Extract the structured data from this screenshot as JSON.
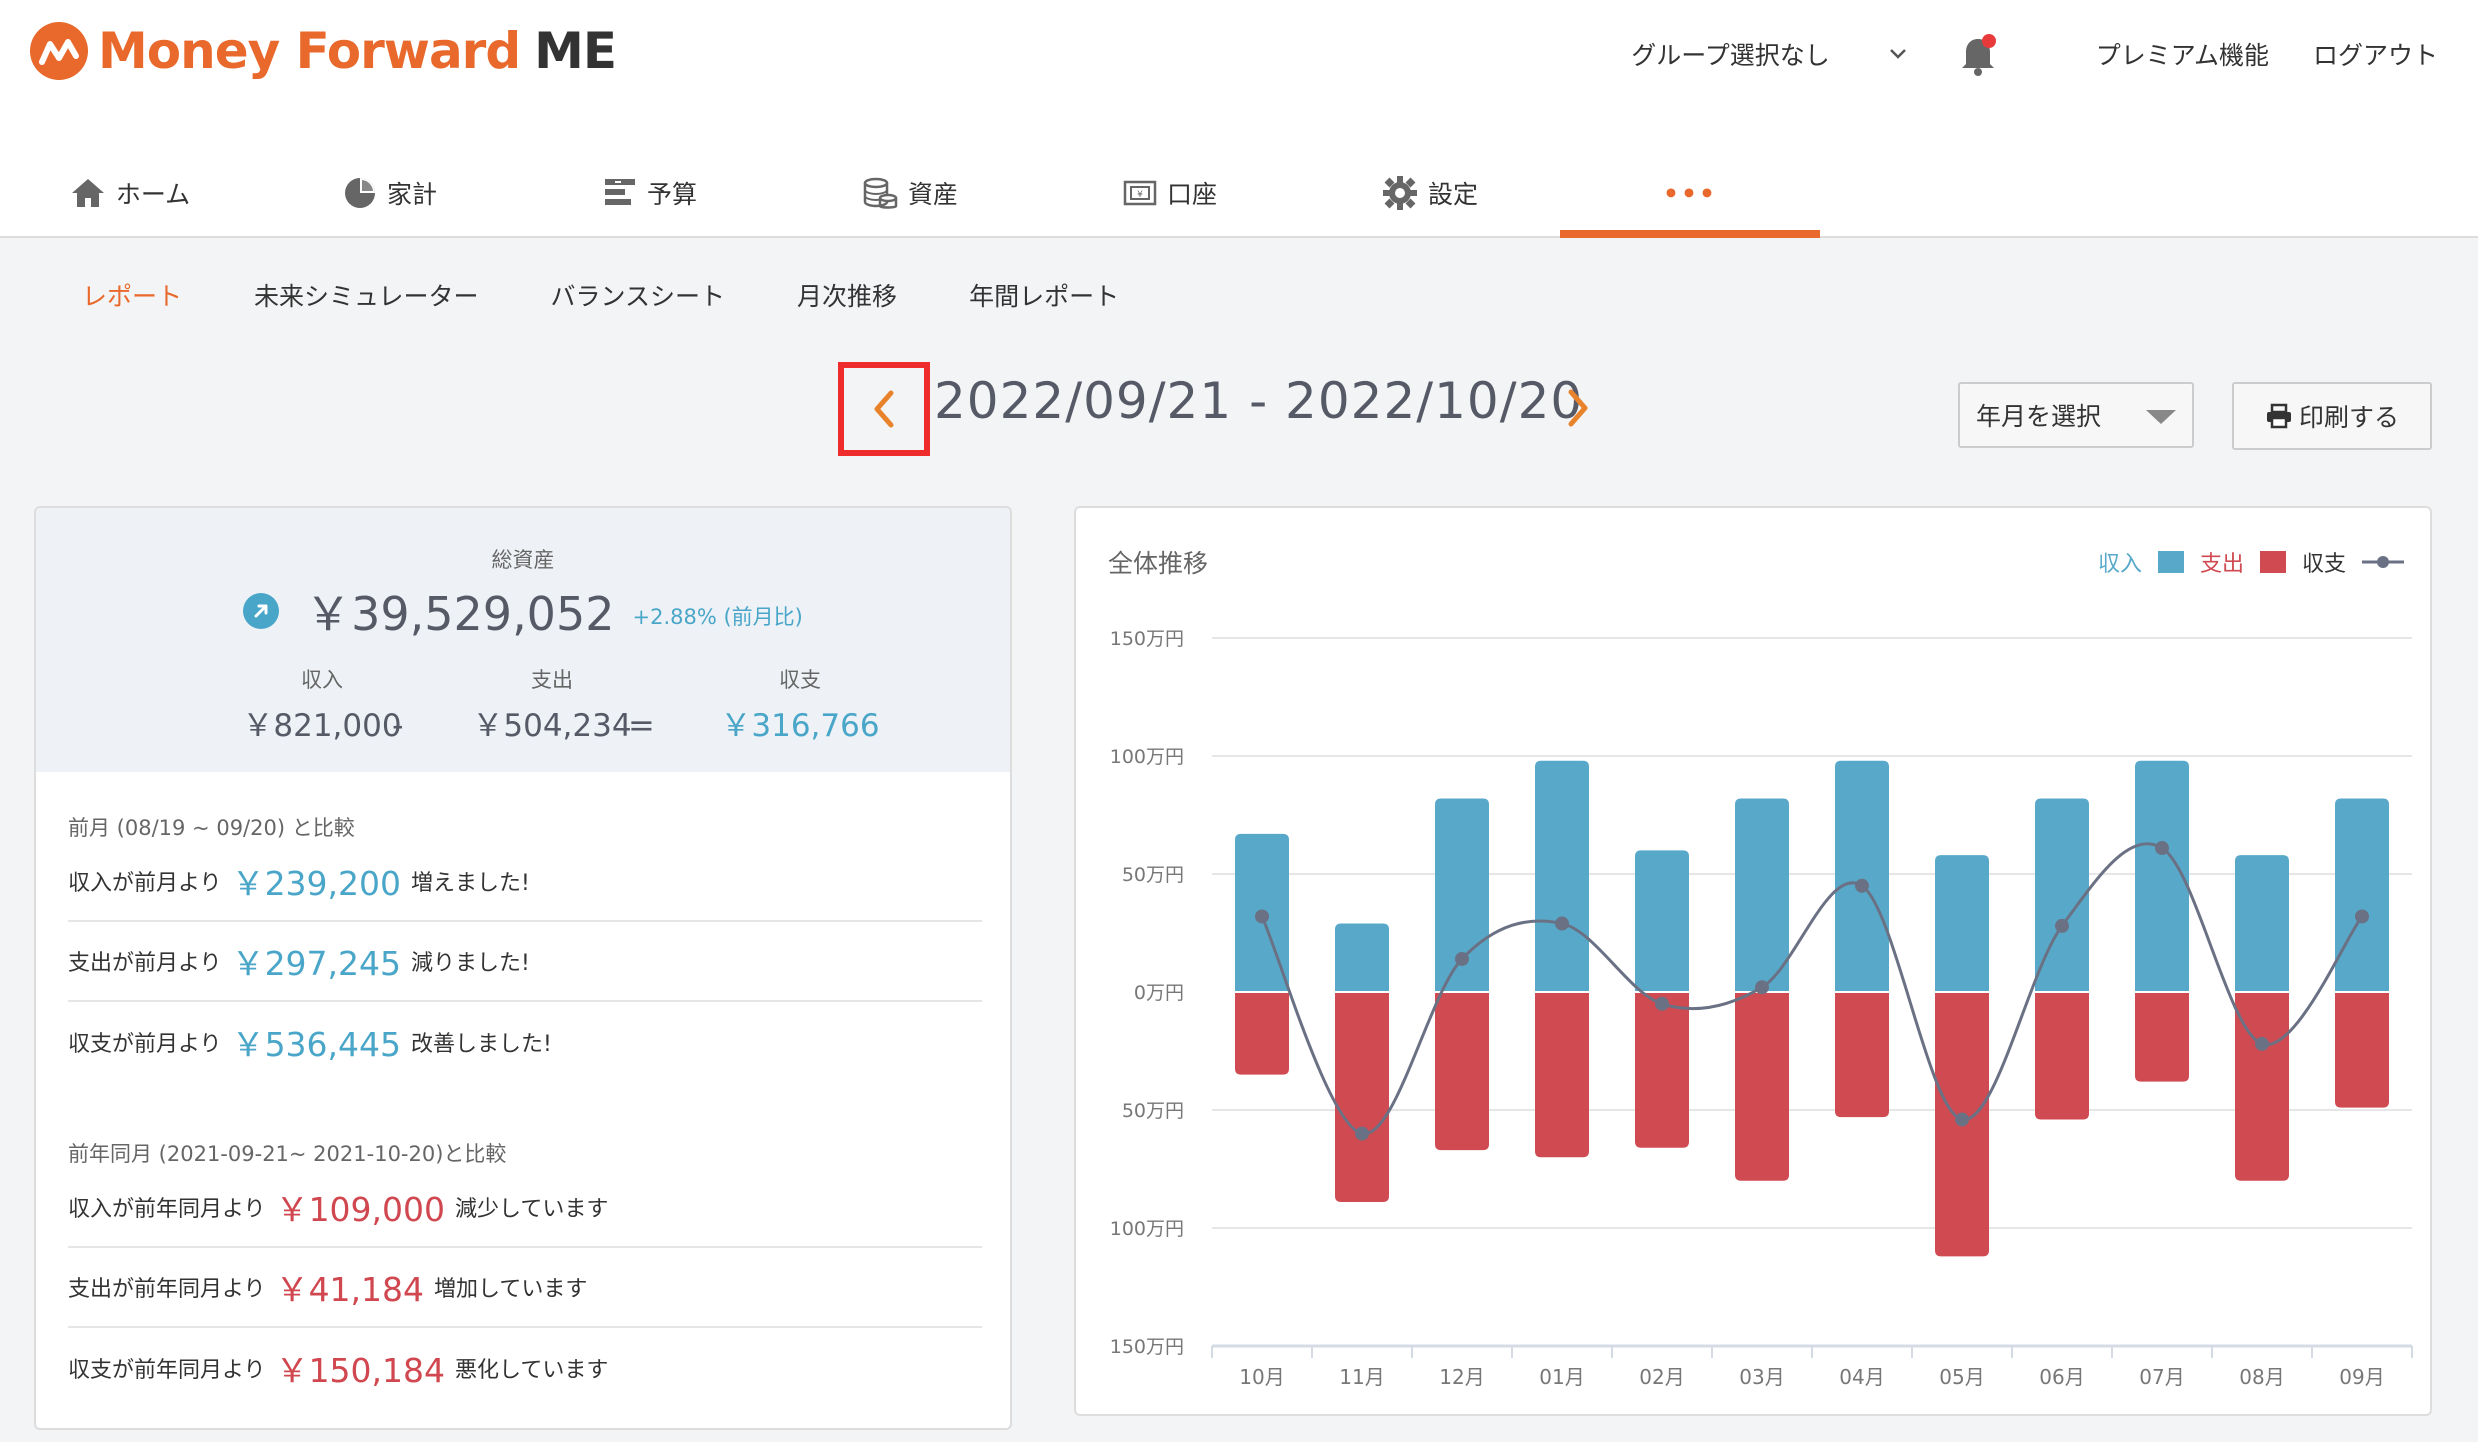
{
  "brand": {
    "name": "Money Forward",
    "suffix": "ME",
    "color": "#e8692b"
  },
  "topnav": {
    "group_select": "グループ選択なし",
    "premium": "プレミアム機能",
    "logout": "ログアウト"
  },
  "mainnav": [
    {
      "label": "ホーム",
      "icon": "home-icon"
    },
    {
      "label": "家計",
      "icon": "pie-icon"
    },
    {
      "label": "予算",
      "icon": "budget-icon"
    },
    {
      "label": "資産",
      "icon": "coins-icon"
    },
    {
      "label": "口座",
      "icon": "account-icon"
    },
    {
      "label": "設定",
      "icon": "gear-icon"
    },
    {
      "label": "•••",
      "icon": "more-icon"
    }
  ],
  "subnav": [
    "レポート",
    "未来シミュレーター",
    "バランスシート",
    "月次推移",
    "年間レポート"
  ],
  "datebar": {
    "range": "2022/09/21 - 2022/10/20",
    "month_select": "年月を選択",
    "print": "印刷する"
  },
  "summary": {
    "total_label": "総資産",
    "total": "￥39,529,052",
    "change": "+2.88% (前月比)",
    "income_label": "収入",
    "income": "￥821,000",
    "minus": "-",
    "expense_label": "支出",
    "expense": "￥504,234",
    "equals": "=",
    "balance_label": "収支",
    "balance": "￥316,766"
  },
  "compare_prev": {
    "heading": "前月 (08/19 ~ 09/20) と比較",
    "rows": [
      {
        "prefix": "収入が前月より",
        "amount": "￥239,200",
        "suffix": "増えました!"
      },
      {
        "prefix": "支出が前月より",
        "amount": "￥297,245",
        "suffix": "減りました!"
      },
      {
        "prefix": "収支が前月より",
        "amount": "￥536,445",
        "suffix": "改善しました!"
      }
    ]
  },
  "compare_year": {
    "heading": "前年同月 (2021-09-21~ 2021-10-20)と比較",
    "rows": [
      {
        "prefix": "収入が前年同月より",
        "amount": "￥109,000",
        "suffix": "減少しています"
      },
      {
        "prefix": "支出が前年同月より",
        "amount": "￥41,184",
        "suffix": "増加しています"
      },
      {
        "prefix": "収支が前年同月より",
        "amount": "￥150,184",
        "suffix": "悪化しています"
      }
    ]
  },
  "chart_data": {
    "type": "bar",
    "title": "全体推移",
    "categories": [
      "10月",
      "11月",
      "12月",
      "01月",
      "02月",
      "03月",
      "04月",
      "05月",
      "06月",
      "07月",
      "08月",
      "09月"
    ],
    "series": [
      {
        "name": "収入",
        "color": "#58a9c9",
        "values": [
          67,
          29,
          82,
          98,
          60,
          82,
          98,
          58,
          82,
          98,
          58,
          82
        ]
      },
      {
        "name": "支出",
        "color": "#d04a51",
        "values": [
          -35,
          -89,
          -67,
          -70,
          -66,
          -80,
          -53,
          -112,
          -54,
          -38,
          -80,
          -49
        ]
      },
      {
        "name": "収支",
        "color": "#6b7184",
        "values": [
          32,
          -60,
          14,
          29,
          -5,
          2,
          45,
          -54,
          28,
          61,
          -22,
          32
        ]
      }
    ],
    "ylim": [
      -150,
      150
    ],
    "yticks": [
      {
        "value": 150,
        "label": "150万円"
      },
      {
        "value": 100,
        "label": "100万円"
      },
      {
        "value": 50,
        "label": "50万円"
      },
      {
        "value": 0,
        "label": "0万円"
      },
      {
        "value": -50,
        "label": "50万円"
      },
      {
        "value": -100,
        "label": "100万円"
      },
      {
        "value": -150,
        "label": "150万円"
      }
    ],
    "legend": "top-right",
    "grid": true
  }
}
